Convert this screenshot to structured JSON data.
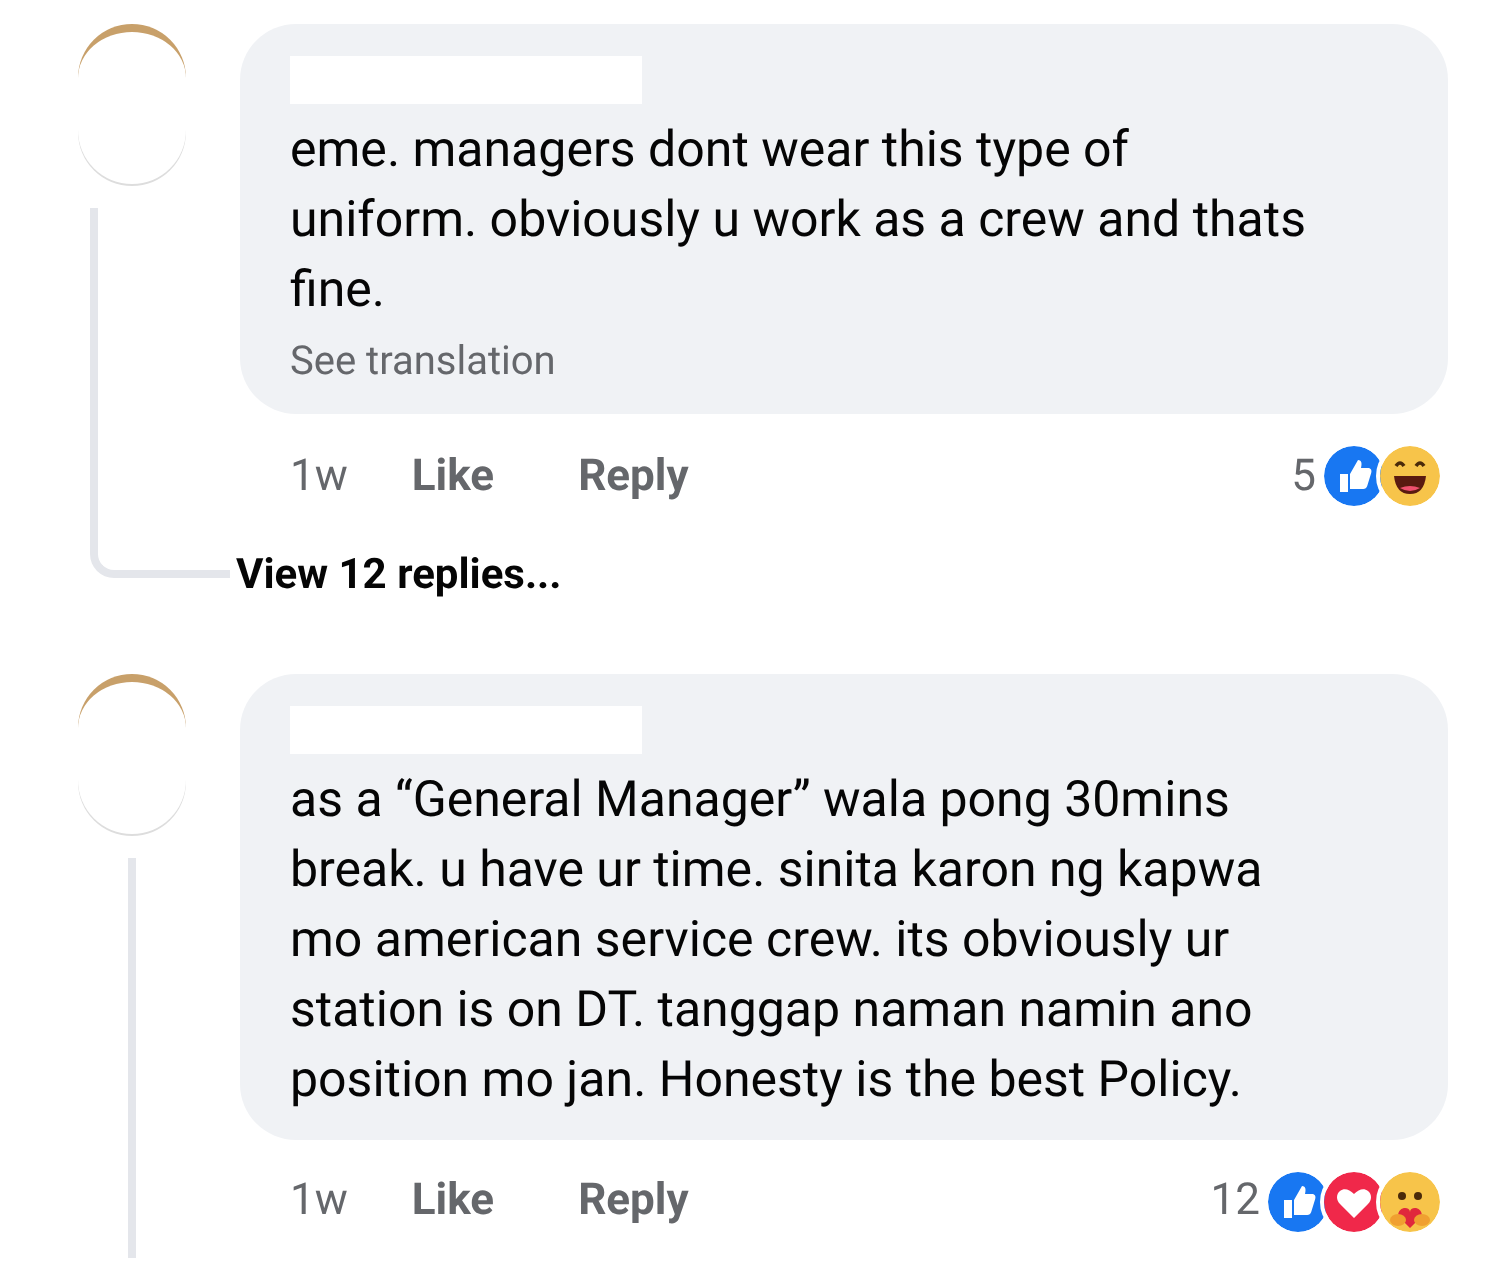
{
  "comments": [
    {
      "text": "eme. managers dont wear this type of uniform. obviously u work as a crew and thats fine.",
      "translation_link": "See translation",
      "time": "1w",
      "like": "Like",
      "reply": "Reply",
      "reaction_count": "5",
      "reactions": [
        {
          "kind": "like"
        },
        {
          "kind": "haha"
        }
      ],
      "view_replies": "View 12 replies..."
    },
    {
      "text": "as a “General Manager” wala pong 30mins break. u have ur time. sinita karon ng kapwa mo american service crew. its obviously ur station is on DT. tanggap naman namin ano position mo jan. Honesty is the best Policy.",
      "time": "1w",
      "like": "Like",
      "reply": "Reply",
      "reaction_count": "12",
      "reactions": [
        {
          "kind": "like"
        },
        {
          "kind": "love"
        },
        {
          "kind": "care"
        }
      ]
    }
  ]
}
